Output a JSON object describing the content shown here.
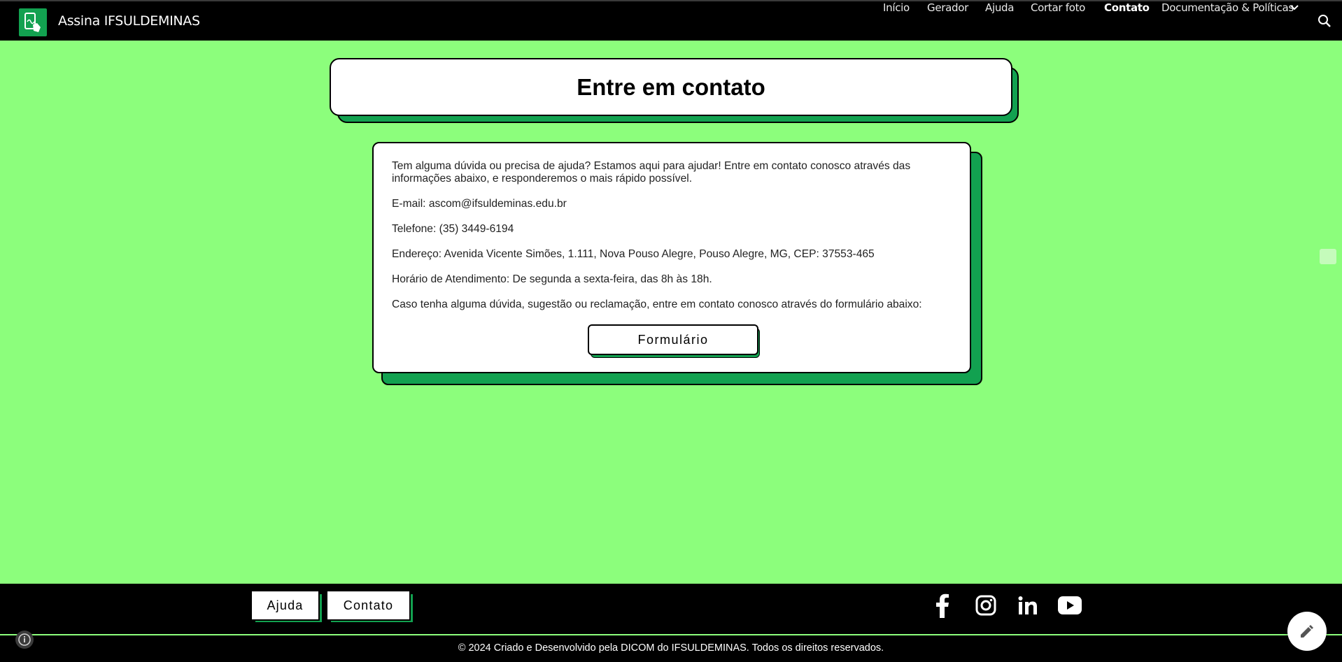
{
  "header": {
    "logo_icon": "tablet-signature-icon",
    "title": "Assina IFSULDEMINAS",
    "nav": [
      {
        "label": "Início",
        "active": false
      },
      {
        "label": "Gerador",
        "active": false
      },
      {
        "label": "Ajuda",
        "active": false
      },
      {
        "label": "Cortar foto",
        "active": false
      },
      {
        "label": "Contato",
        "active": true
      },
      {
        "label": "Documentação & Políticas",
        "active": false,
        "dropdown": true
      }
    ],
    "search_icon": "search-icon"
  },
  "main": {
    "heading": "Entre em contato",
    "paragraphs": {
      "intro": "Tem alguma dúvida ou precisa de ajuda? Estamos aqui para ajudar! Entre em contato conosco através das informações abaixo, e responderemos o mais rápido possível.",
      "email": "E-mail: ascom@ifsuldeminas.edu.br",
      "phone": "Telefone: (35) 3449-6194",
      "address": "Endereço: Avenida Vicente Simões, 1.111, Nova Pouso Alegre, Pouso Alegre, MG, CEP: 37553-465",
      "hours": "Horário de Atendimento: De segunda a sexta-feira, das 8h às 18h.",
      "form_note": "Caso tenha alguma dúvida, sugestão ou reclamação, entre em contato conosco através do formulário abaixo:"
    },
    "form_button": "Formulário"
  },
  "footer": {
    "buttons": {
      "help": "Ajuda",
      "contact": "Contato"
    },
    "social_icons": [
      "facebook-icon",
      "instagram-icon",
      "linkedin-icon",
      "youtube-icon"
    ],
    "copyright": "© 2024 Criado e Desenvolvido pela DICOM do IFSULDEMINAS. Todos os direitos reservados."
  },
  "colors": {
    "page_background": "#8cfe7c",
    "accent_green": "#12a150",
    "bar_black": "#000000"
  }
}
